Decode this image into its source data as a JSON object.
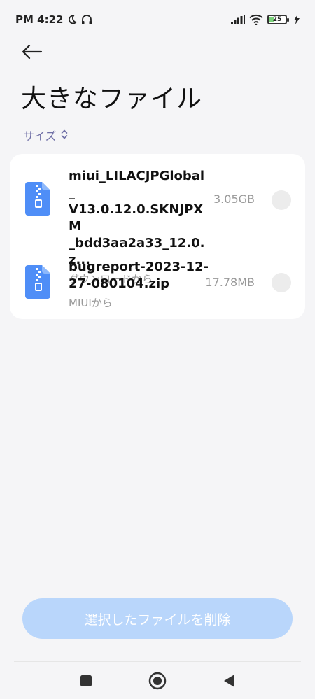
{
  "status_bar": {
    "time": "PM 4:22",
    "battery_level": "25",
    "icons": [
      "moon-icon",
      "headphones-icon",
      "signal-icon",
      "wifi-icon",
      "battery-icon",
      "charging-icon"
    ]
  },
  "header": {
    "back_icon": "arrow-left-icon",
    "title": "大きなファイル"
  },
  "sort": {
    "label": "サイズ",
    "icon": "sort-updown-icon"
  },
  "files": [
    {
      "name": "miui_LILACJPGlobal_V13.0.12.0.SKNJPXM_bdd3aa2a33_12.0.z...",
      "name_lines": [
        "miui_LILACJPGlobal_",
        "V13.0.12.0.SKNJPXM",
        "_bdd3aa2a33_12.0.z..."
      ],
      "source": "ダウンロードから",
      "size": "3.05GB",
      "selected": false
    },
    {
      "name": "bugreport-2023-12-27-080104.zip",
      "name_lines": [
        "bugreport-2023-12-",
        "27-080104.zip"
      ],
      "source": "MIUIから",
      "size": "17.78MB",
      "selected": false
    }
  ],
  "delete_button": {
    "label": "選択したファイルを削除",
    "enabled": false
  },
  "colors": {
    "accent": "#4f8ef7",
    "button_disabled": "#b9d6fb",
    "sort_text": "#6f6fa6",
    "background": "#f5f5f7"
  },
  "nav_bar": {
    "icons": [
      "recents-square-icon",
      "home-circle-icon",
      "back-triangle-icon"
    ]
  }
}
